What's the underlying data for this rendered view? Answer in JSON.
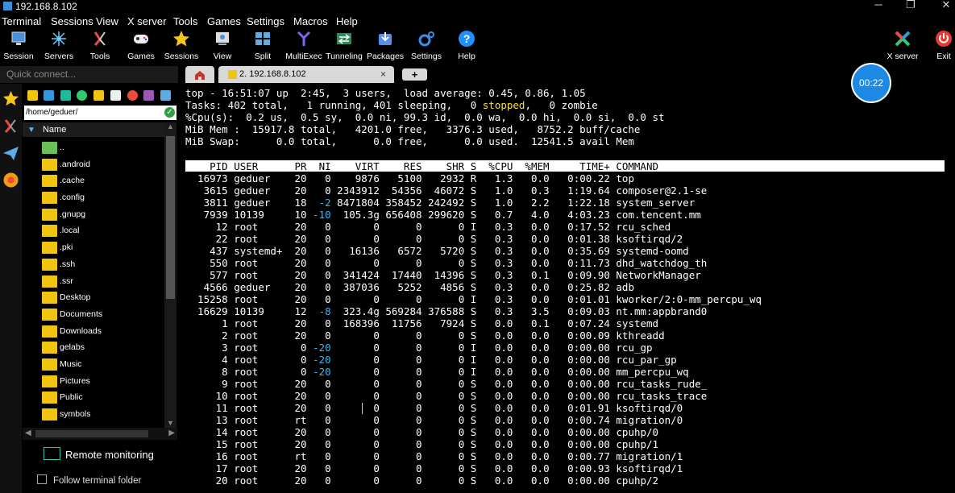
{
  "window": {
    "title": "192.168.8.102",
    "minimize": "─",
    "maximize": "❐",
    "close": "✕"
  },
  "menu": [
    "Terminal",
    "Sessions",
    "View",
    "X server",
    "Tools",
    "Games",
    "Settings",
    "Macros",
    "Help"
  ],
  "toolbar": {
    "items": [
      {
        "label": "Session",
        "icon": "session-icon"
      },
      {
        "label": "Servers",
        "icon": "servers-icon"
      },
      {
        "label": "Tools",
        "icon": "tools-icon"
      },
      {
        "label": "Games",
        "icon": "gamepad-icon"
      },
      {
        "label": "Sessions",
        "icon": "star-icon"
      },
      {
        "label": "View",
        "icon": "view-icon"
      },
      {
        "label": "Split",
        "icon": "split-icon"
      },
      {
        "label": "MultiExec",
        "icon": "multiexec-icon"
      },
      {
        "label": "Tunneling",
        "icon": "tunneling-icon"
      },
      {
        "label": "Packages",
        "icon": "packages-icon"
      },
      {
        "label": "Settings",
        "icon": "gear-icon"
      },
      {
        "label": "Help",
        "icon": "help-icon"
      }
    ],
    "xserver_label": "X server",
    "exit_label": "Exit"
  },
  "quick_connect": {
    "placeholder": "Quick connect..."
  },
  "sidebar": {
    "path": "/home/geduer/",
    "column_header": "Name",
    "files": [
      {
        "name": "..",
        "type": "parent"
      },
      {
        "name": ".android",
        "type": "folder"
      },
      {
        "name": ".cache",
        "type": "folder"
      },
      {
        "name": ".config",
        "type": "folder"
      },
      {
        "name": ".gnupg",
        "type": "folder"
      },
      {
        "name": ".local",
        "type": "folder"
      },
      {
        "name": ".pki",
        "type": "folder"
      },
      {
        "name": ".ssh",
        "type": "folder"
      },
      {
        "name": ".ssr",
        "type": "folder"
      },
      {
        "name": "Desktop",
        "type": "folder"
      },
      {
        "name": "Documents",
        "type": "folder"
      },
      {
        "name": "Downloads",
        "type": "folder"
      },
      {
        "name": "gelabs",
        "type": "folder"
      },
      {
        "name": "Music",
        "type": "folder"
      },
      {
        "name": "Pictures",
        "type": "folder"
      },
      {
        "name": "Public",
        "type": "folder"
      },
      {
        "name": "symbols",
        "type": "folder"
      }
    ],
    "remote_monitoring": "Remote monitoring",
    "follow_folder": "Follow terminal folder"
  },
  "tabs": {
    "active": "2. 192.168.8.102",
    "close": "×",
    "new": "+"
  },
  "timer": "00:22",
  "terminal": {
    "summary": [
      "top - 16:51:07 up  2:45,  3 users,  load average: 0.45, 0.86, 1.05",
      "%Cpu(s):  0.2 us,  0.5 sy,  0.0 ni, 99.3 id,  0.0 wa,  0.0 hi,  0.0 si,  0.0 st",
      "MiB Mem :  15917.8 total,   4201.0 free,   3376.3 used,   8752.2 buff/cache",
      "MiB Swap:      0.0 total,      0.0 free,      0.0 used.  12541.5 avail Mem"
    ],
    "tasks_a": "Tasks: 402 total,   1 running, 401 sleeping,   0 ",
    "tasks_stopped": "stopped",
    "tasks_b": ",   0 zombie",
    "header": "    PID USER      PR  NI    VIRT    RES    SHR S  %CPU  %MEM     TIME+ COMMAND",
    "processes": [
      {
        "pid": "16973",
        "user": "geduer",
        "pr": "20",
        "ni": "0",
        "virt": "9876",
        "res": "5100",
        "shr": "2932",
        "s": "R",
        "cpu": "1.3",
        "mem": "0.0",
        "time": "0:00.22",
        "cmd": "top"
      },
      {
        "pid": "3615",
        "user": "geduer",
        "pr": "20",
        "ni": "0",
        "virt": "2343912",
        "res": "54356",
        "shr": "46072",
        "s": "S",
        "cpu": "1.0",
        "mem": "0.3",
        "time": "1:19.64",
        "cmd": "composer@2.1-se"
      },
      {
        "pid": "3811",
        "user": "geduer",
        "pr": "18",
        "ni": "-2",
        "virt": "8471804",
        "res": "358452",
        "shr": "242492",
        "s": "S",
        "cpu": "1.0",
        "mem": "2.2",
        "time": "1:22.18",
        "cmd": "system_server"
      },
      {
        "pid": "7939",
        "user": "10139",
        "pr": "10",
        "ni": "-10",
        "virt": "105.3g",
        "res": "656408",
        "shr": "299620",
        "s": "S",
        "cpu": "0.7",
        "mem": "4.0",
        "time": "4:03.23",
        "cmd": "com.tencent.mm"
      },
      {
        "pid": "12",
        "user": "root",
        "pr": "20",
        "ni": "0",
        "virt": "0",
        "res": "0",
        "shr": "0",
        "s": "I",
        "cpu": "0.3",
        "mem": "0.0",
        "time": "0:17.52",
        "cmd": "rcu_sched"
      },
      {
        "pid": "22",
        "user": "root",
        "pr": "20",
        "ni": "0",
        "virt": "0",
        "res": "0",
        "shr": "0",
        "s": "S",
        "cpu": "0.3",
        "mem": "0.0",
        "time": "0:01.38",
        "cmd": "ksoftirqd/2"
      },
      {
        "pid": "437",
        "user": "systemd+",
        "pr": "20",
        "ni": "0",
        "virt": "16136",
        "res": "6572",
        "shr": "5720",
        "s": "S",
        "cpu": "0.3",
        "mem": "0.0",
        "time": "0:35.69",
        "cmd": "systemd-oomd"
      },
      {
        "pid": "550",
        "user": "root",
        "pr": "20",
        "ni": "0",
        "virt": "0",
        "res": "0",
        "shr": "0",
        "s": "S",
        "cpu": "0.3",
        "mem": "0.0",
        "time": "0:11.73",
        "cmd": "dhd_watchdog_th"
      },
      {
        "pid": "577",
        "user": "root",
        "pr": "20",
        "ni": "0",
        "virt": "341424",
        "res": "17440",
        "shr": "14396",
        "s": "S",
        "cpu": "0.3",
        "mem": "0.1",
        "time": "0:09.90",
        "cmd": "NetworkManager"
      },
      {
        "pid": "4566",
        "user": "geduer",
        "pr": "20",
        "ni": "0",
        "virt": "387036",
        "res": "5252",
        "shr": "4856",
        "s": "S",
        "cpu": "0.3",
        "mem": "0.0",
        "time": "0:25.82",
        "cmd": "adb"
      },
      {
        "pid": "15258",
        "user": "root",
        "pr": "20",
        "ni": "0",
        "virt": "0",
        "res": "0",
        "shr": "0",
        "s": "I",
        "cpu": "0.3",
        "mem": "0.0",
        "time": "0:01.01",
        "cmd": "kworker/2:0-mm_percpu_wq"
      },
      {
        "pid": "16629",
        "user": "10139",
        "pr": "12",
        "ni": "-8",
        "virt": "323.4g",
        "res": "569284",
        "shr": "376588",
        "s": "S",
        "cpu": "0.3",
        "mem": "3.5",
        "time": "0:09.03",
        "cmd": "nt.mm:appbrand0"
      },
      {
        "pid": "1",
        "user": "root",
        "pr": "20",
        "ni": "0",
        "virt": "168396",
        "res": "11756",
        "shr": "7924",
        "s": "S",
        "cpu": "0.0",
        "mem": "0.1",
        "time": "0:07.24",
        "cmd": "systemd"
      },
      {
        "pid": "2",
        "user": "root",
        "pr": "20",
        "ni": "0",
        "virt": "0",
        "res": "0",
        "shr": "0",
        "s": "S",
        "cpu": "0.0",
        "mem": "0.0",
        "time": "0:00.09",
        "cmd": "kthreadd"
      },
      {
        "pid": "3",
        "user": "root",
        "pr": "0",
        "ni": "-20",
        "virt": "0",
        "res": "0",
        "shr": "0",
        "s": "I",
        "cpu": "0.0",
        "mem": "0.0",
        "time": "0:00.00",
        "cmd": "rcu_gp"
      },
      {
        "pid": "4",
        "user": "root",
        "pr": "0",
        "ni": "-20",
        "virt": "0",
        "res": "0",
        "shr": "0",
        "s": "I",
        "cpu": "0.0",
        "mem": "0.0",
        "time": "0:00.00",
        "cmd": "rcu_par_gp"
      },
      {
        "pid": "8",
        "user": "root",
        "pr": "0",
        "ni": "-20",
        "virt": "0",
        "res": "0",
        "shr": "0",
        "s": "I",
        "cpu": "0.0",
        "mem": "0.0",
        "time": "0:00.00",
        "cmd": "mm_percpu_wq"
      },
      {
        "pid": "9",
        "user": "root",
        "pr": "20",
        "ni": "0",
        "virt": "0",
        "res": "0",
        "shr": "0",
        "s": "S",
        "cpu": "0.0",
        "mem": "0.0",
        "time": "0:00.00",
        "cmd": "rcu_tasks_rude_"
      },
      {
        "pid": "10",
        "user": "root",
        "pr": "20",
        "ni": "0",
        "virt": "0",
        "res": "0",
        "shr": "0",
        "s": "S",
        "cpu": "0.0",
        "mem": "0.0",
        "time": "0:00.00",
        "cmd": "rcu_tasks_trace"
      },
      {
        "pid": "11",
        "user": "root",
        "pr": "20",
        "ni": "0",
        "virt": "0",
        "res": "0",
        "shr": "0",
        "s": "S",
        "cpu": "0.0",
        "mem": "0.0",
        "time": "0:01.91",
        "cmd": "ksoftirqd/0"
      },
      {
        "pid": "13",
        "user": "root",
        "pr": "rt",
        "ni": "0",
        "virt": "0",
        "res": "0",
        "shr": "0",
        "s": "S",
        "cpu": "0.0",
        "mem": "0.0",
        "time": "0:00.74",
        "cmd": "migration/0"
      },
      {
        "pid": "14",
        "user": "root",
        "pr": "20",
        "ni": "0",
        "virt": "0",
        "res": "0",
        "shr": "0",
        "s": "S",
        "cpu": "0.0",
        "mem": "0.0",
        "time": "0:00.00",
        "cmd": "cpuhp/0"
      },
      {
        "pid": "15",
        "user": "root",
        "pr": "20",
        "ni": "0",
        "virt": "0",
        "res": "0",
        "shr": "0",
        "s": "S",
        "cpu": "0.0",
        "mem": "0.0",
        "time": "0:00.00",
        "cmd": "cpuhp/1"
      },
      {
        "pid": "16",
        "user": "root",
        "pr": "rt",
        "ni": "0",
        "virt": "0",
        "res": "0",
        "shr": "0",
        "s": "S",
        "cpu": "0.0",
        "mem": "0.0",
        "time": "0:00.77",
        "cmd": "migration/1"
      },
      {
        "pid": "17",
        "user": "root",
        "pr": "20",
        "ni": "0",
        "virt": "0",
        "res": "0",
        "shr": "0",
        "s": "S",
        "cpu": "0.0",
        "mem": "0.0",
        "time": "0:00.93",
        "cmd": "ksoftirqd/1"
      },
      {
        "pid": "20",
        "user": "root",
        "pr": "20",
        "ni": "0",
        "virt": "0",
        "res": "0",
        "shr": "0",
        "s": "S",
        "cpu": "0.0",
        "mem": "0.0",
        "time": "0:00.00",
        "cmd": "cpuhp/2"
      }
    ]
  }
}
